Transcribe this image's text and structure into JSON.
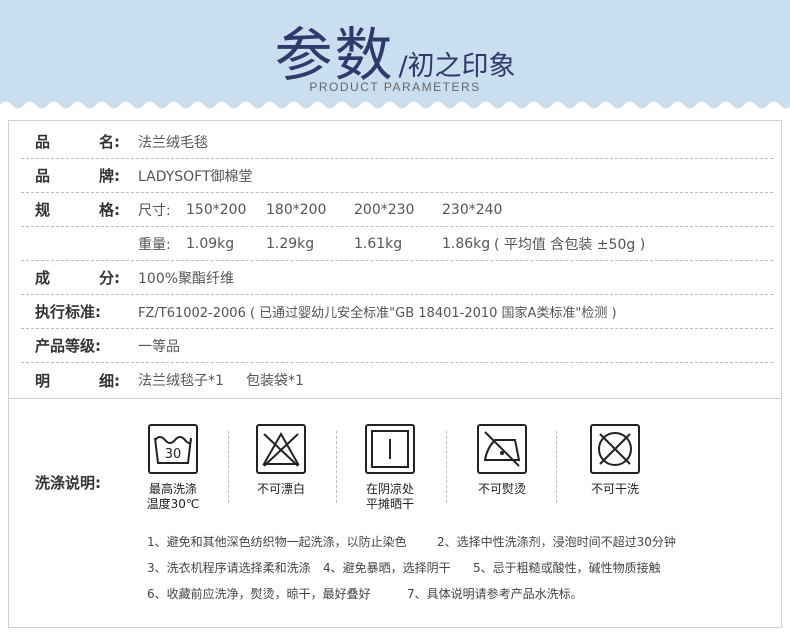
{
  "header": {
    "title_main": "参数",
    "title_sub": "/初之印象",
    "title_en": "PRODUCT PARAMETERS"
  },
  "rows": {
    "name_label_a": "品",
    "name_label_b": "名:",
    "name_value": "法兰绒毛毯",
    "brand_label_a": "品",
    "brand_label_b": "牌:",
    "brand_value": "LADYSOFT御棉堂",
    "spec_label_a": "规",
    "spec_label_b": "格:",
    "spec_size_prefix": "尺寸:",
    "spec_sizes": [
      "150*200",
      "180*200",
      "200*230",
      "230*240"
    ],
    "weight_prefix": "重量:",
    "weights": [
      "1.09kg",
      "1.29kg",
      "1.61kg",
      "1.86kg"
    ],
    "weight_note": "( 平均值 含包装 ±50g )",
    "material_label_a": "成",
    "material_label_b": "分:",
    "material_value": "100%聚酯纤维",
    "standard_label": "执行标准:",
    "standard_value": "FZ/T61002-2006 ( 已通过婴幼儿安全标准\"GB 18401-2010 国家A类标准\"检测 )",
    "grade_label": "产品等级:",
    "grade_value": "一等品",
    "detail_label_a": "明",
    "detail_label_b": "细:",
    "detail_items": [
      "法兰绒毯子*1",
      "包装袋*1"
    ]
  },
  "wash": {
    "label": "洗涤说明:",
    "icons": [
      {
        "icon": "wash-30-icon",
        "number": "30",
        "caption_1": "最高洗涤",
        "caption_2": "温度30℃"
      },
      {
        "icon": "no-bleach-icon",
        "caption_1": "不可漂白",
        "caption_2": ""
      },
      {
        "icon": "dry-flat-shade-icon",
        "caption_1": "在阴凉处",
        "caption_2": "平摊晒干"
      },
      {
        "icon": "no-iron-icon",
        "caption_1": "不可熨烫",
        "caption_2": ""
      },
      {
        "icon": "no-dry-clean-icon",
        "caption_1": "不可干洗",
        "caption_2": ""
      }
    ],
    "notes": [
      [
        "1、避免和其他深色纺织物一起洗涤，以防止染色",
        "2、选择中性洗涤剂，浸泡时间不超过30分钟"
      ],
      [
        "3、洗衣机程序请选择柔和洗涤",
        "4、避免暴晒，选择阴干",
        "5、忌于粗糙或酸性，碱性物质接触"
      ],
      [
        "6、收藏前应洗净，熨烫，晾干，最好叠好",
        "7、具体说明请参考产品水洗标。"
      ]
    ]
  },
  "colors": {
    "banner": "#c9deef",
    "title": "#2d3a6b"
  }
}
